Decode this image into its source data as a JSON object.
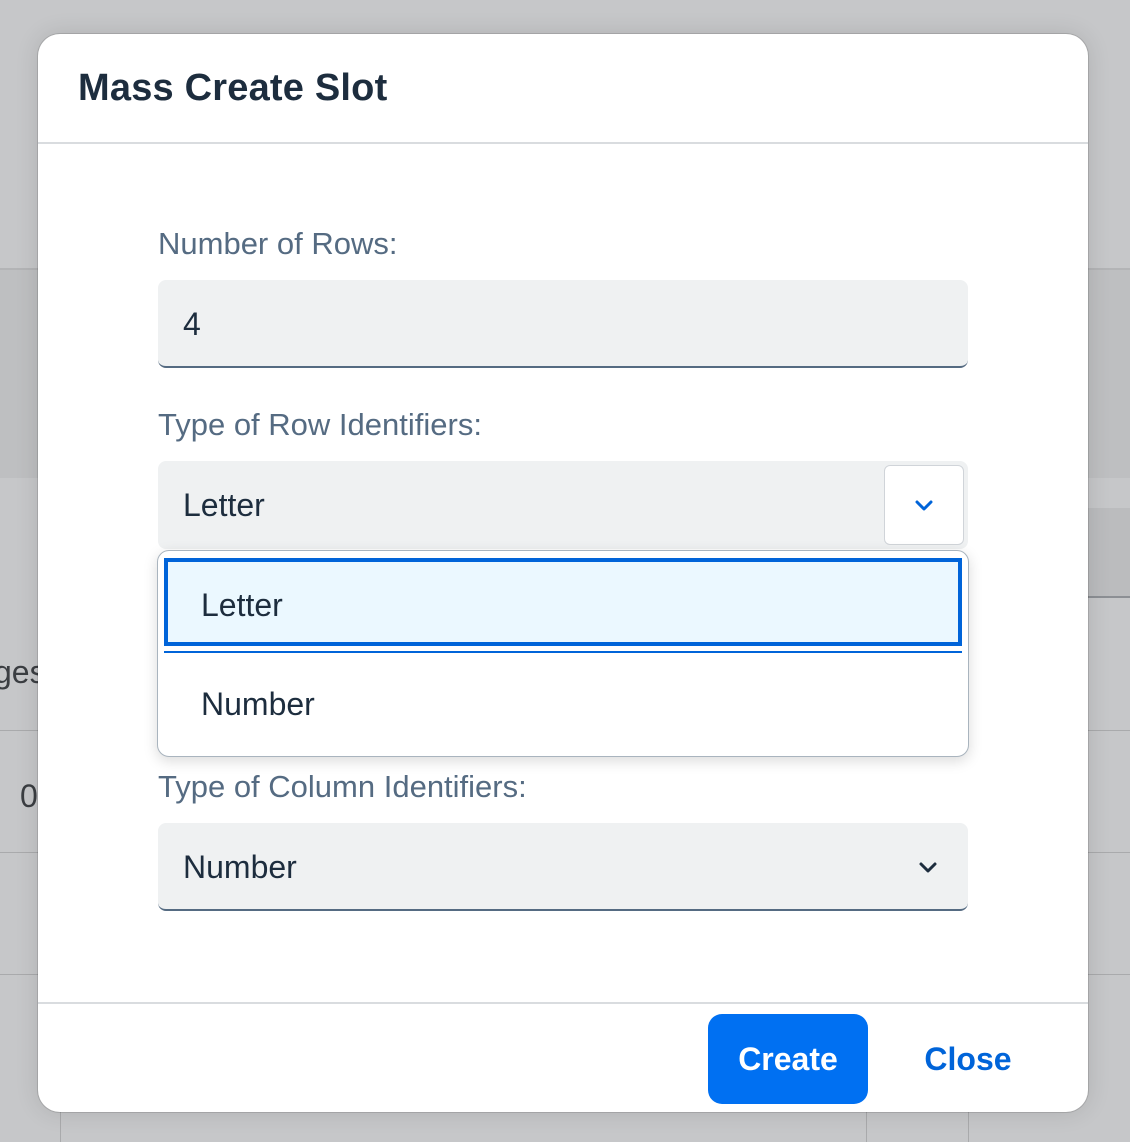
{
  "background": {
    "fragment_left_header": "ges",
    "fragment_left_cell": "0"
  },
  "dialog": {
    "title": "Mass Create Slot",
    "fields": {
      "rows": {
        "label": "Number of Rows:",
        "value": "4"
      },
      "row_type": {
        "label": "Type of Row Identifiers:",
        "value": "Letter",
        "expanded": true
      },
      "col_type": {
        "label": "Type of Column Identifiers:",
        "value": "Number"
      }
    },
    "dropdown_options": [
      {
        "label": "Letter",
        "selected": true
      },
      {
        "label": "Number",
        "selected": false
      }
    ],
    "footer": {
      "create_label": "Create",
      "close_label": "Close"
    }
  },
  "colors": {
    "accent": "#0070f2",
    "link": "#0064d9",
    "field_bg": "#eff1f2",
    "selected_option_bg": "#ebf8ff"
  },
  "icons": {
    "dropdown": "chevron-down-icon"
  }
}
